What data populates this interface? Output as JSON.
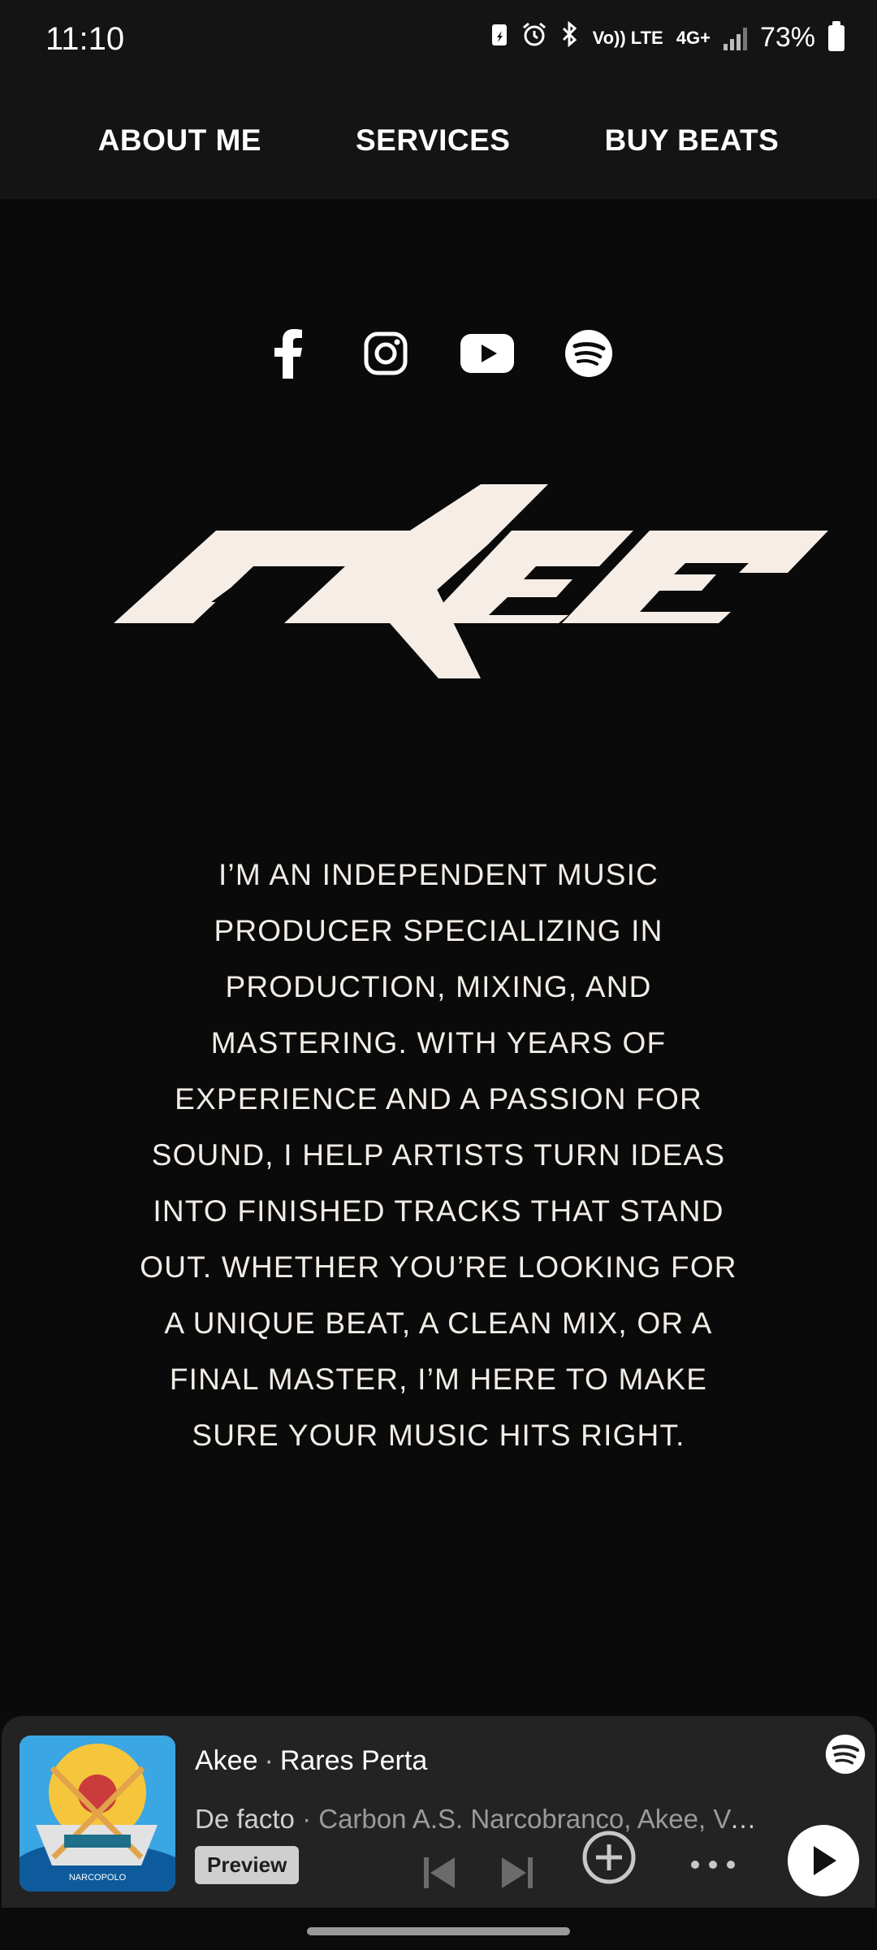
{
  "status_bar": {
    "time": "11:10",
    "volte": "Vo)) LTE",
    "network": "4G+",
    "battery": "73%"
  },
  "nav": {
    "items": [
      "ABOUT ME",
      "SERVICES",
      "BUY BEATS"
    ]
  },
  "social": [
    "facebook",
    "instagram",
    "youtube",
    "spotify"
  ],
  "logo": {
    "text": "akee"
  },
  "bio": {
    "text": "I’M AN INDEPENDENT MUSIC PRODUCER SPECIALIZING IN PRODUCTION, MIXING, AND MASTERING. WITH YEARS OF EXPERIENCE AND A PASSION FOR SOUND, I HELP ARTISTS TURN IDEAS INTO FINISHED TRACKS THAT STAND OUT. WHETHER YOU’RE LOOKING FOR A UNIQUE BEAT, A CLEAN MIX, OR A FINAL MASTER, I’M HERE TO MAKE SURE YOUR MUSIC HITS RIGHT."
  },
  "player": {
    "artist": "Akee",
    "artist2": "Rares Perta",
    "track": "De facto",
    "album_artists": "Carbon A.S. Narcobranco, Akee, Ve...",
    "preview_label": "Preview",
    "cover_text": "NARCOPOLO"
  },
  "colors": {
    "background": "#0a0a0a",
    "navbar": "#141414",
    "player": "#232323",
    "logo": "#f5ede6"
  }
}
